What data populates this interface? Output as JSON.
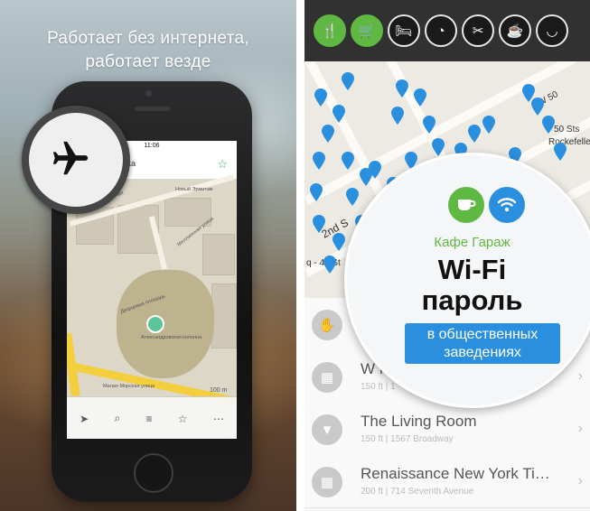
{
  "left": {
    "headline_line1": "Работает без интернета,",
    "headline_line2": "работает везде",
    "phone": {
      "time": "11:06",
      "nav_title": "етка",
      "map_labels": {
        "street1": "Дворцовая набережная",
        "street2": "Миллионная улица",
        "square": "Дворцовая площадь",
        "column": "Александровская колонна",
        "hermitage": "Новый Эрмитаж",
        "bottom_street": "Малая Морская улица",
        "scale": "100 m"
      }
    },
    "icons": {
      "magnifier": "airplane-icon",
      "star": "star-outline-icon"
    }
  },
  "right": {
    "categories": [
      {
        "icon": "fork-knife-icon",
        "active": true
      },
      {
        "icon": "cart-icon",
        "active": true
      },
      {
        "icon": "bed-icon",
        "active": false
      },
      {
        "icon": "pizza-icon",
        "active": false
      },
      {
        "icon": "tools-icon",
        "active": false
      },
      {
        "icon": "beer-mug-icon",
        "active": false
      },
      {
        "icon": "noodle-bowl-icon",
        "active": false
      }
    ],
    "map_labels": {
      "w50": "W 50",
      "sts": "50 Sts",
      "rockefeller": "Rockefelle",
      "second": "2nd S",
      "fortytwo": "q - 42 St"
    },
    "bubble": {
      "place": "Кафе Гараж",
      "title_line1": "Wi-Fi",
      "title_line2": "пароль",
      "tag_line1": "в общественных",
      "tag_line2": "заведениях"
    },
    "rows": [
      {
        "name": "",
        "sub": "",
        "icon": "hand-icon"
      },
      {
        "name": "W N",
        "sub": "150 ft | 1",
        "icon": "building-icon"
      },
      {
        "name": "The Living Room",
        "sub": "150 ft | 1567 Broadway",
        "icon": "cocktail-icon"
      },
      {
        "name": "Renaissance New York Ti…",
        "sub": "200 ft | 714 Seventh Avenue",
        "icon": "building-icon"
      }
    ],
    "colors": {
      "green": "#5fb842",
      "blue": "#2a8fdf",
      "pin": "#2a8fdf"
    }
  }
}
